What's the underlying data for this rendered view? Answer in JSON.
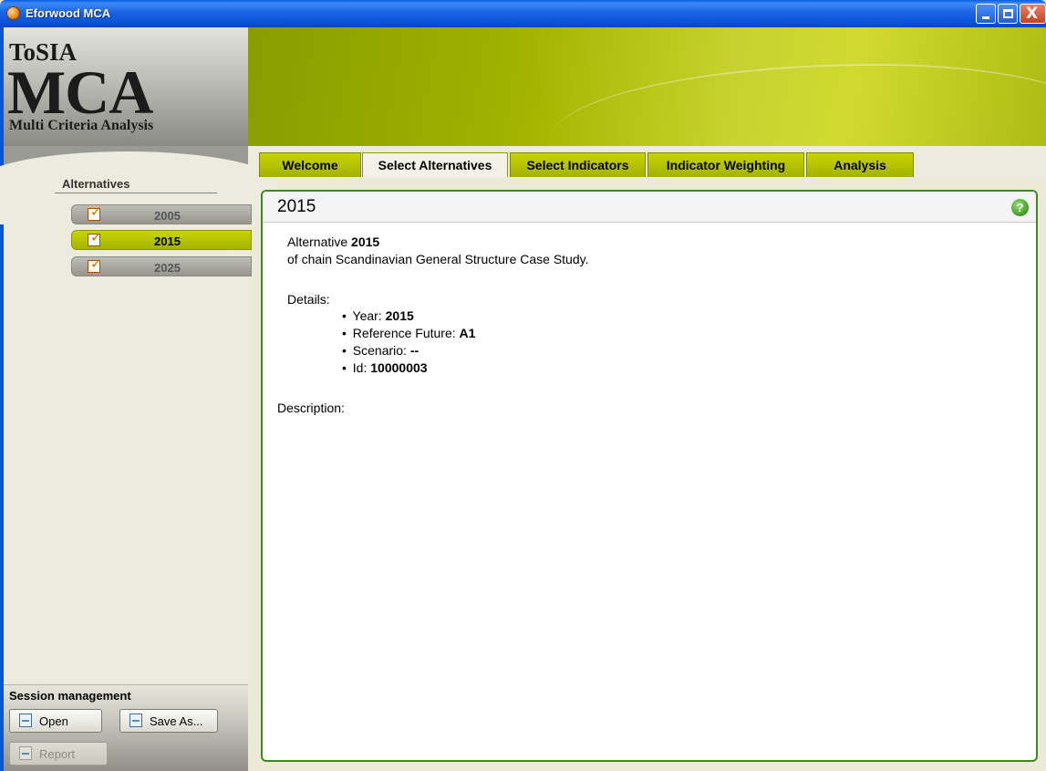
{
  "window": {
    "title": "Eforwood MCA",
    "close_glyph": "X"
  },
  "logo": {
    "line1": "ToSIA",
    "line2": "MCA",
    "line3": "Multi Criteria Analysis"
  },
  "sidebar": {
    "heading": "Alternatives",
    "items": [
      {
        "label": "2005",
        "selected": false
      },
      {
        "label": "2015",
        "selected": true
      },
      {
        "label": "2025",
        "selected": false
      }
    ]
  },
  "session": {
    "label": "Session management",
    "open": "Open",
    "save_as": "Save As...",
    "report": "Report"
  },
  "tabs": [
    {
      "label": "Welcome"
    },
    {
      "label": "Select Alternatives",
      "active": true
    },
    {
      "label": "Select Indicators"
    },
    {
      "label": "Indicator Weighting"
    },
    {
      "label": "Analysis"
    }
  ],
  "panel": {
    "title": "2015",
    "help_glyph": "?",
    "alternative_prefix": "Alternative ",
    "alternative_name": "2015",
    "chain_line": "of chain Scandinavian General Structure Case Study.",
    "details_label": "Details:",
    "year_label": "Year: ",
    "year_value": "2015",
    "ref_label": "Reference Future: ",
    "ref_value": "A1",
    "scenario_label": "Scenario: ",
    "scenario_value": "--",
    "id_label": "Id: ",
    "id_value": "10000003",
    "description_label": "Description:"
  },
  "colors": {
    "accent_green": "#a5b400",
    "panel_border": "#3c8a1e",
    "titlebar_blue": "#0a54d8"
  }
}
